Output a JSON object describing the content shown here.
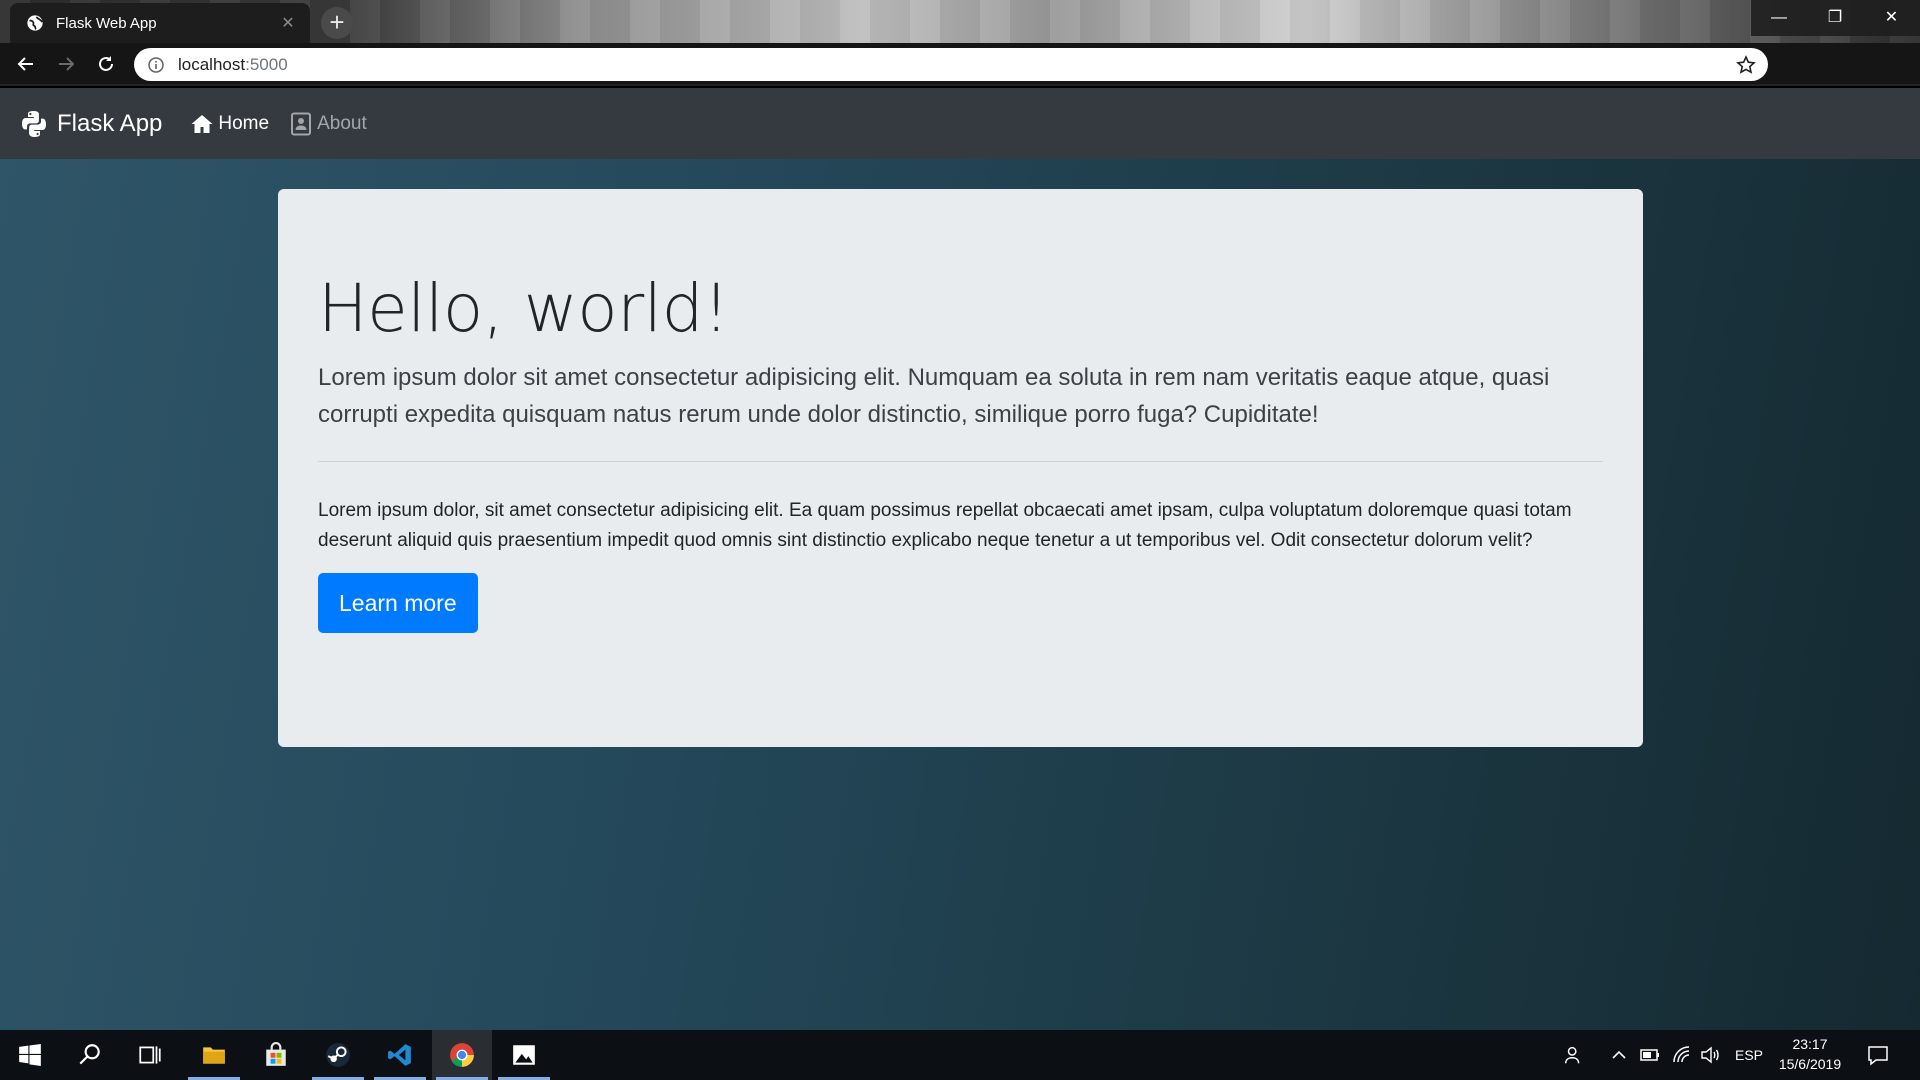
{
  "browser": {
    "tab": {
      "title": "Flask Web App",
      "close_glyph": "✕",
      "favicon": "globe-icon"
    },
    "new_tab_glyph": "+",
    "window_controls": {
      "minimize": "—",
      "maximize": "❐",
      "close": "✕"
    },
    "address": {
      "host": "localhost",
      "port": ":5000"
    }
  },
  "site": {
    "brand": "Flask App",
    "nav": [
      {
        "label": "Home",
        "icon": "home-icon",
        "active": true
      },
      {
        "label": "About",
        "icon": "contact-card-icon",
        "active": false
      }
    ]
  },
  "jumbotron": {
    "heading": "Hello, world!",
    "lead": "Lorem ipsum dolor sit amet consectetur adipisicing elit. Numquam ea soluta in rem nam veritatis eaque atque, quasi corrupti expedita quisquam natus rerum unde dolor distinctio, similique porro fuga? Cupiditate!",
    "body": "Lorem ipsum dolor, sit amet consectetur adipisicing elit. Ea quam possimus repellat obcaecati amet ipsam, culpa voluptatum doloremque quasi totam deserunt aliquid quis praesentium impedit quod omnis sint distinctio explicabo neque tenetur a ut temporibus vel. Odit consectetur dolorum velit?",
    "button": "Learn more"
  },
  "taskbar": {
    "language": "ESP",
    "time": "23:17",
    "date": "15/6/2019"
  },
  "colors": {
    "navbar": "#343a40",
    "jumbotron": "#e9ecef",
    "primary": "#007bff"
  }
}
